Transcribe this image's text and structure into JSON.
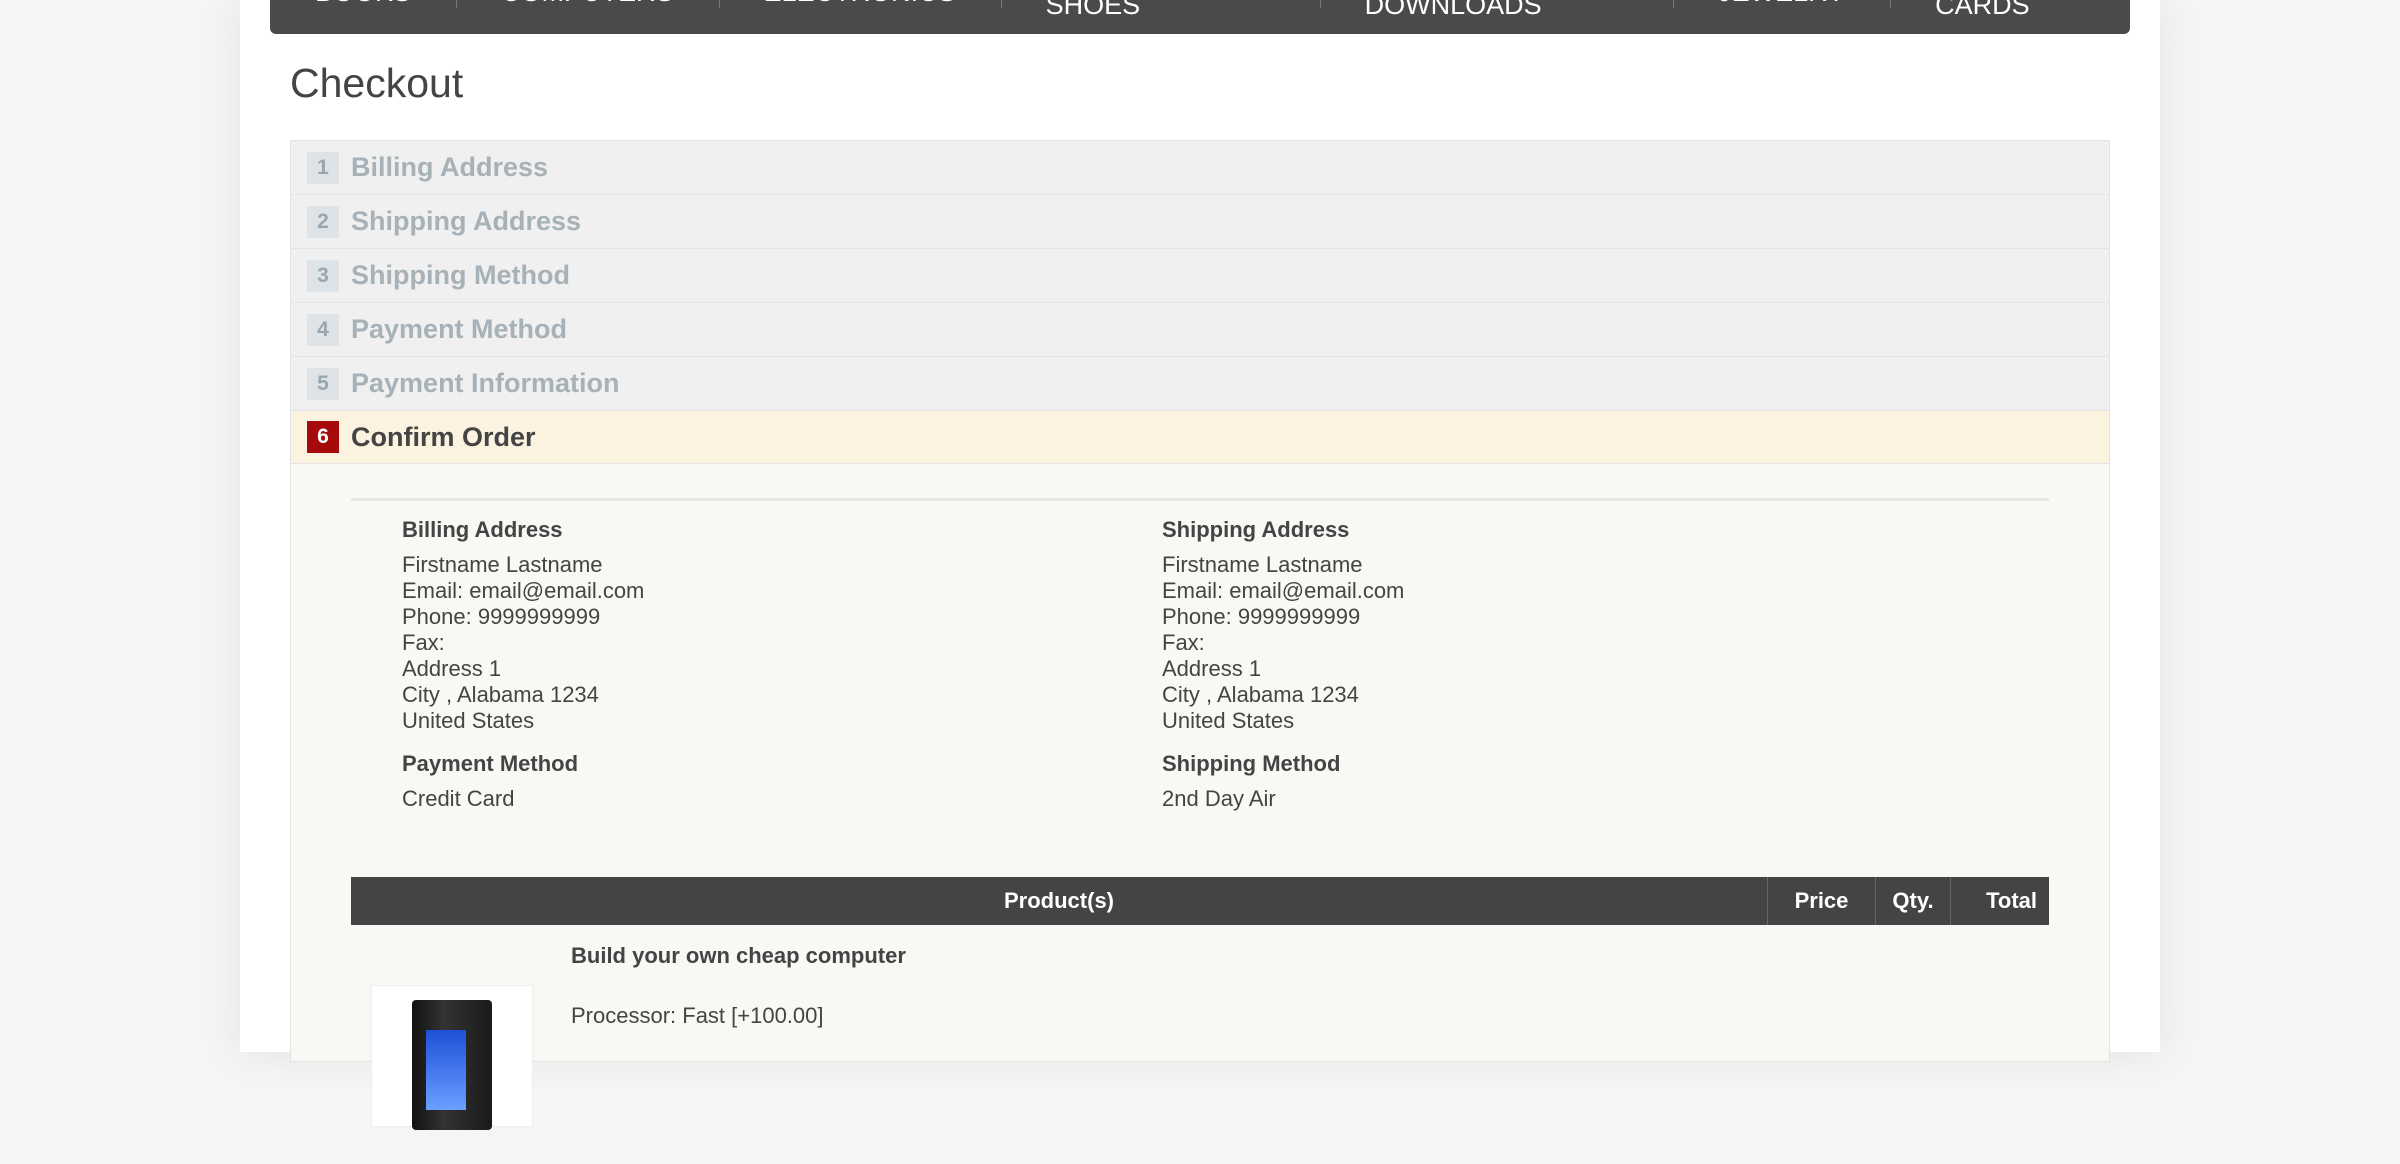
{
  "nav": {
    "items": [
      "Books",
      "Computers",
      "Electronics",
      "Apparel & Shoes",
      "Digital downloads",
      "Jewelry",
      "Gift Cards"
    ]
  },
  "page_title": "Checkout",
  "steps": [
    {
      "num": "1",
      "title": "Billing Address"
    },
    {
      "num": "2",
      "title": "Shipping Address"
    },
    {
      "num": "3",
      "title": "Shipping Method"
    },
    {
      "num": "4",
      "title": "Payment Method"
    },
    {
      "num": "5",
      "title": "Payment Information"
    },
    {
      "num": "6",
      "title": "Confirm Order"
    }
  ],
  "billing": {
    "title": "Billing Address",
    "name": "Firstname Lastname",
    "email": "Email: email@email.com",
    "phone": "Phone: 9999999999",
    "fax": "Fax:",
    "address": "Address 1",
    "city": "City , Alabama 1234",
    "country": "United States"
  },
  "shipping": {
    "title": "Shipping Address",
    "name": "Firstname Lastname",
    "email": "Email: email@email.com",
    "phone": "Phone: 9999999999",
    "fax": "Fax:",
    "address": "Address 1",
    "city": "City , Alabama 1234",
    "country": "United States"
  },
  "payment_method": {
    "title": "Payment Method",
    "value": "Credit Card"
  },
  "shipping_method": {
    "title": "Shipping Method",
    "value": "2nd Day Air"
  },
  "cart": {
    "headers": {
      "product": "Product(s)",
      "price": "Price",
      "qty": "Qty.",
      "total": "Total"
    },
    "items": [
      {
        "name": "Build your own cheap computer",
        "attributes": "Processor: Fast [+100.00]"
      }
    ]
  }
}
